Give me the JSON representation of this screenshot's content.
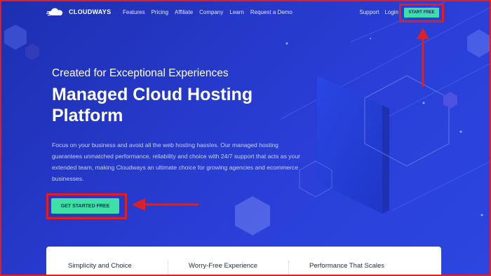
{
  "brand": {
    "name": "CLOUDWAYS"
  },
  "nav": {
    "items": [
      "Features",
      "Pricing",
      "Affiliate",
      "Company",
      "Learn",
      "Request a Demo"
    ],
    "support": "Support",
    "login": "Login",
    "start_free": "START FREE"
  },
  "hero": {
    "subheading": "Created for Exceptional Experiences",
    "headline": "Managed Cloud Hosting Platform",
    "description": "Focus on your business and avoid all the web hosting hassles. Our managed hosting guarantees unmatched performance, reliability and choice with 24/7 support that acts as your extended team, making Cloudways an ultimate choice for growing agencies and ecommerce businesses.",
    "cta": "GET STARTED FREE"
  },
  "features": [
    "Simplicity and Choice",
    "Worry-Free Experience",
    "Performance That Scales"
  ],
  "colors": {
    "accent": "#3ee0a8",
    "background": "#2538c8",
    "annotation": "#e02020"
  }
}
